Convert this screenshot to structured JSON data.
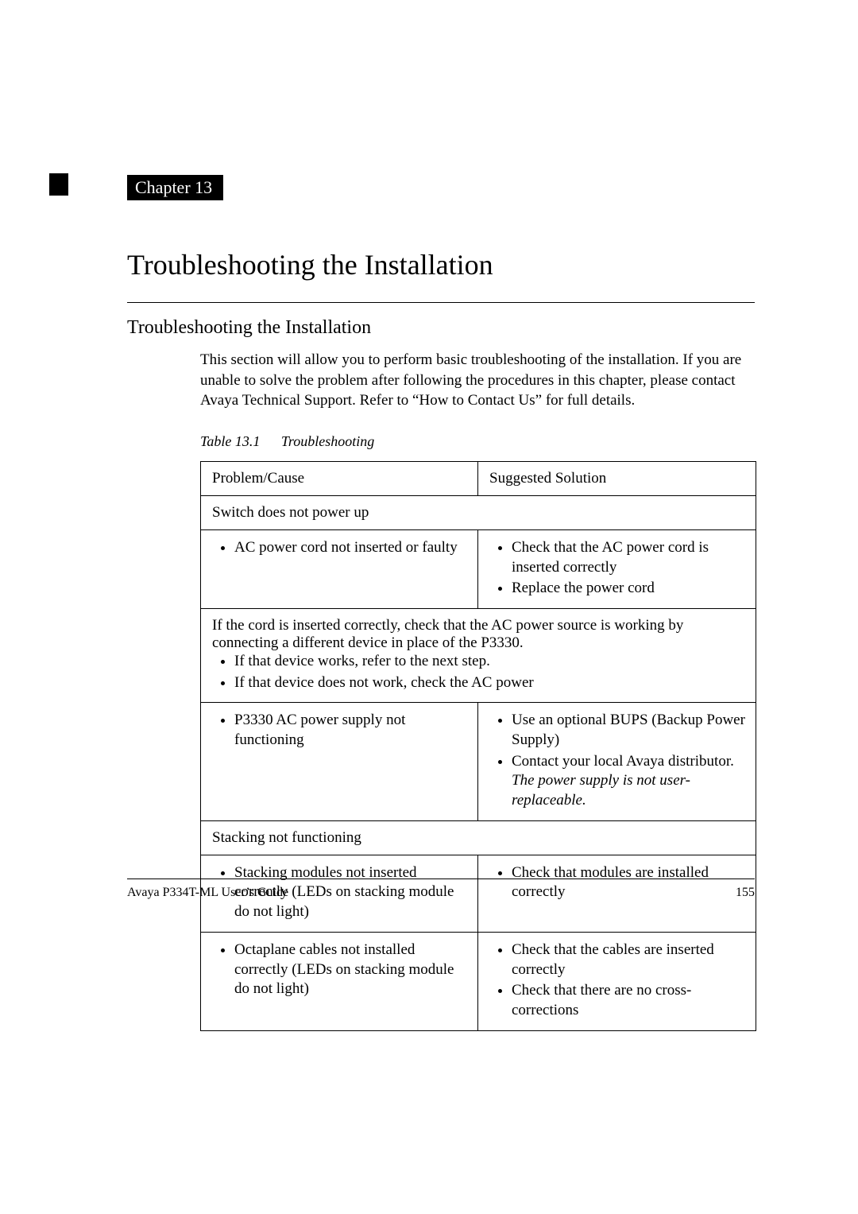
{
  "chapter_label": "Chapter 13",
  "main_title": "Troubleshooting the Installation",
  "section_heading": "Troubleshooting the Installation",
  "intro_text": "This section will allow you to perform basic troubleshooting of the installation. If you are unable to solve the problem after following the procedures in this chapter, please contact Avaya Technical Support. Refer to “How to Contact Us” for full details.",
  "table": {
    "caption_number": "Table 13.1",
    "caption_title": "Troubleshooting",
    "headers": {
      "col1": "Problem/Cause",
      "col2": "Suggested Solution"
    },
    "section1": {
      "title": "Switch does not power up",
      "row1": {
        "problem": "AC power cord not inserted or faulty",
        "solution_items": [
          "Check that the AC power cord is inserted correctly",
          "Replace the power cord"
        ]
      },
      "note_text": "If the cord is inserted correctly, check that the AC power source is working by connecting a different device in place of the P3330.",
      "note_items": [
        "If that device works, refer to the next step.",
        "If that device does not work, check the AC power"
      ],
      "row2": {
        "problem": "P3330 AC power supply not functioning",
        "solution_item1": "Use an optional BUPS (Backup Power Supply)",
        "solution_item2_text": "Contact your local Avaya distributor. ",
        "solution_item2_italic": "The power supply is not user-replaceable."
      }
    },
    "section2": {
      "title": "Stacking not functioning",
      "row1": {
        "problem": "Stacking modules not inserted correctly (LEDs on stacking module do not light)",
        "solution_items": [
          "Check that modules are installed correctly"
        ]
      },
      "row2": {
        "problem": "Octaplane cables not installed correctly (LEDs on stacking module do not light)",
        "solution_items": [
          "Check that the cables are inserted correctly",
          "Check that there are no cross-corrections"
        ]
      }
    }
  },
  "footer": {
    "left": "Avaya P334T-ML User’s Guide",
    "right": "155"
  }
}
